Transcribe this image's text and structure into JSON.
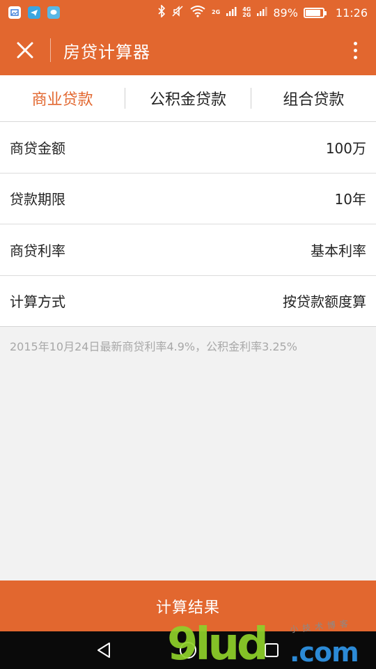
{
  "status_bar": {
    "network_2g": "2G",
    "network_4g": "4G",
    "network_2g_b": "2G",
    "battery_text": "89%",
    "battery_level": 0.89,
    "time": "11:26"
  },
  "header": {
    "title": "房贷计算器"
  },
  "tabs": [
    {
      "label": "商业贷款",
      "active": true
    },
    {
      "label": "公积金贷款",
      "active": false
    },
    {
      "label": "组合贷款",
      "active": false
    }
  ],
  "form": {
    "rows": [
      {
        "label": "商贷金额",
        "value": "100万"
      },
      {
        "label": "贷款期限",
        "value": "10年"
      },
      {
        "label": "商贷利率",
        "value": "基本利率"
      },
      {
        "label": "计算方式",
        "value": "按贷款额度算"
      }
    ]
  },
  "note": "2015年10月24日最新商贷利率4.9%，公积金利率3.25%",
  "actions": {
    "calculate_label": "计算结果"
  },
  "watermark": {
    "main": "9lud",
    "domain": ".com",
    "sub": "小技术博客"
  },
  "colors": {
    "accent": "#e2672f",
    "background": "#f2f2f2",
    "nav_bar": "#0a0a0a"
  }
}
